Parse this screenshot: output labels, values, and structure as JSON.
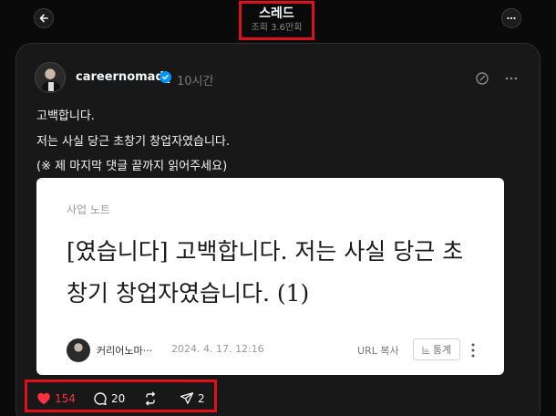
{
  "header": {
    "title": "스레드",
    "views": "조회 3.6만회"
  },
  "post": {
    "author": "careernomad_",
    "time": "10시간",
    "lines": [
      "고백합니다.",
      "저는 사실 당근 초창기 창업자였습니다.",
      "(※ 제 마지막 댓글 끝까지 읽어주세요)"
    ],
    "link_card": {
      "category": "사업 노트",
      "title": "[였습니다] 고백합니다. 저는 사실 당근 초창기 창업자였습니다. (1)",
      "author": "커리어노마···",
      "date": "2024. 4. 17. 12:16",
      "url_copy": "URL 복사",
      "stats": "통계"
    },
    "actions": {
      "likes": "154",
      "replies": "20",
      "shares": "2"
    }
  },
  "colors": {
    "background": "#0a0a0a",
    "card": "#181818",
    "like": "#ff3040",
    "verified": "#0095f6",
    "highlight": "#e0101a"
  },
  "icons": [
    "back-arrow-icon",
    "more-icon",
    "verified-badge-icon",
    "edit-icon",
    "heart-icon",
    "comment-icon",
    "repost-icon",
    "share-icon",
    "stats-icon",
    "kebab-icon"
  ]
}
